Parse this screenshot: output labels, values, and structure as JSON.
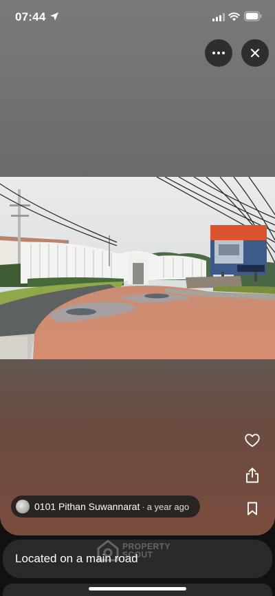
{
  "status_bar": {
    "time": "07:44"
  },
  "post": {
    "author": "0101 Pithan Suwannarat",
    "separator": "·",
    "time_ago": "a year ago",
    "caption": "Located on a main road"
  },
  "watermark": {
    "line1": "PROPERTY",
    "line2": "SCOUT"
  },
  "icons": {
    "location": "location-arrow-icon",
    "signal": "cellular-signal-icon",
    "wifi": "wifi-icon",
    "battery": "battery-icon",
    "more": "more-dots-icon",
    "close": "close-icon",
    "like": "heart-icon",
    "share": "share-icon",
    "save": "bookmark-icon"
  }
}
